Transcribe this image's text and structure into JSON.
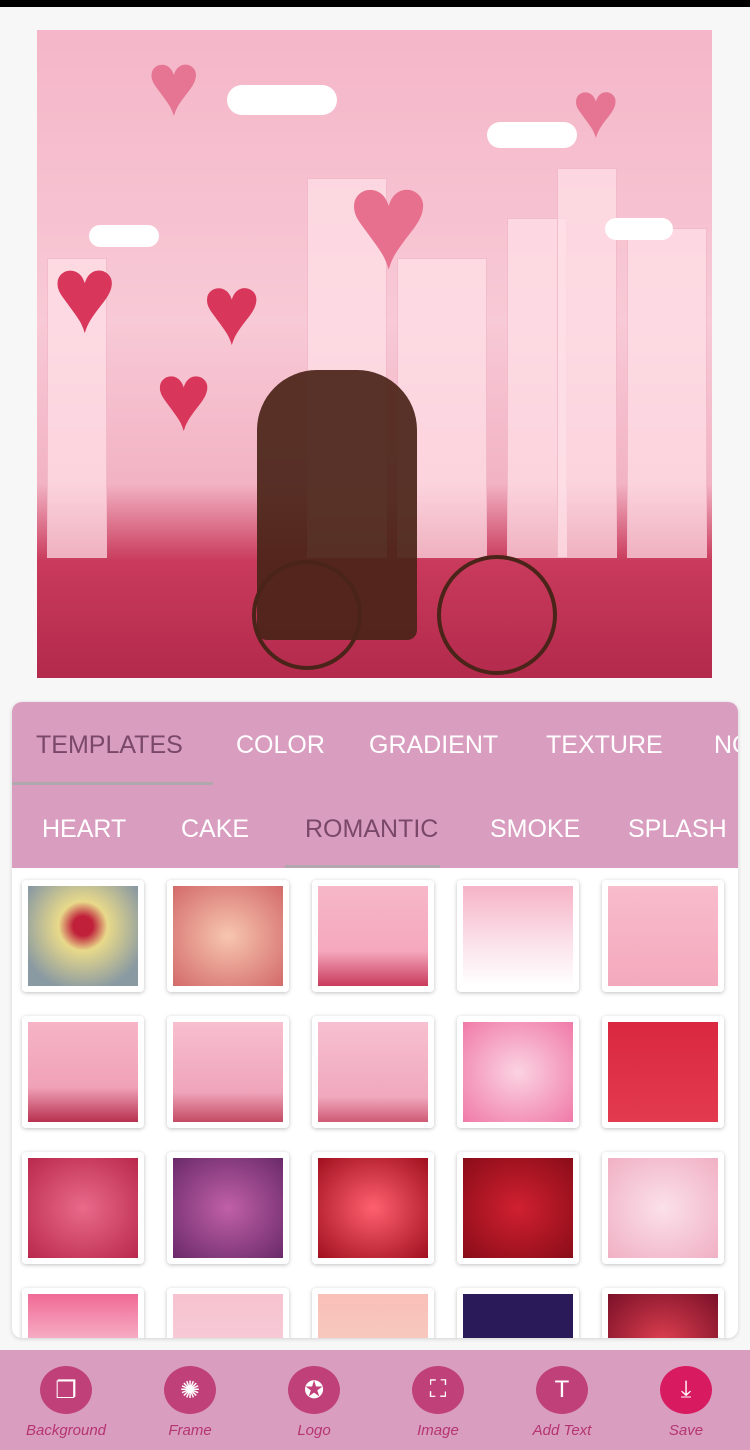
{
  "tabs_main": [
    {
      "label": "TEMPLATES",
      "selected": true
    },
    {
      "label": "COLOR"
    },
    {
      "label": "GRADIENT"
    },
    {
      "label": "TEXTURE"
    },
    {
      "label": "NO"
    }
  ],
  "tabs_sub": [
    {
      "label": "HEART"
    },
    {
      "label": "CAKE"
    },
    {
      "label": "ROMANTIC",
      "selected": true
    },
    {
      "label": "SMOKE"
    },
    {
      "label": "SPLASH"
    }
  ],
  "toolbar": [
    {
      "label": "Background",
      "icon": "background-icon"
    },
    {
      "label": "Frame",
      "icon": "frame-icon"
    },
    {
      "label": "Logo",
      "icon": "logo-icon"
    },
    {
      "label": "Image",
      "icon": "image-add-icon"
    },
    {
      "label": "Add Text",
      "icon": "text-icon"
    },
    {
      "label": "Save",
      "icon": "save-icon"
    }
  ],
  "colors": {
    "accent": "#d99dc0",
    "icon_bg": "#c0417a",
    "save_bg": "#d81b60",
    "selected_tab": "#7a4868"
  }
}
